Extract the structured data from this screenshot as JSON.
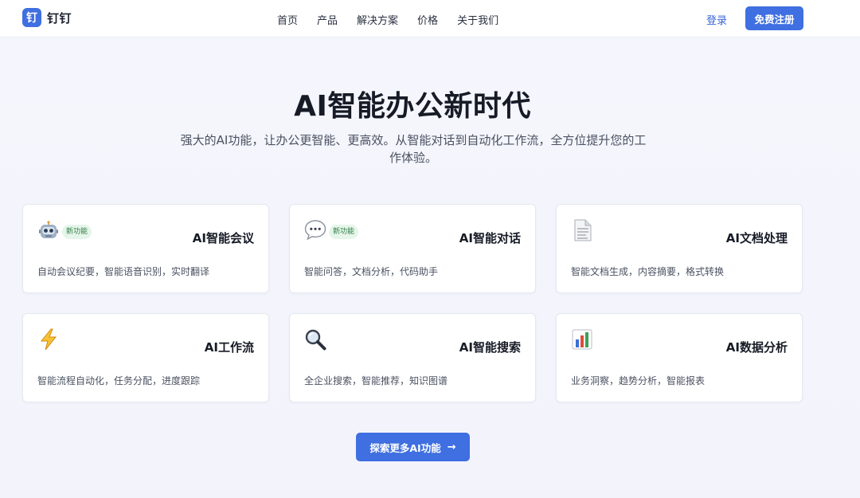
{
  "header": {
    "logo_glyph": "钉",
    "brand": "钉钉",
    "nav": [
      "首页",
      "产品",
      "解决方案",
      "价格",
      "关于我们"
    ],
    "login": "登录",
    "signup": "免费注册"
  },
  "hero": {
    "title": "AI智能办公新时代",
    "subtitle": "强大的AI功能，让办公更智能、更高效。从智能对话到自动化工作流，全方位提升您的工作体验。"
  },
  "features": [
    {
      "icon": "robot-icon",
      "badge": "新功能",
      "title": "AI智能会议",
      "desc": "自动会议纪要，智能语音识别，实时翻译"
    },
    {
      "icon": "speech-bubble-icon",
      "badge": "新功能",
      "title": "AI智能对话",
      "desc": "智能问答，文档分析，代码助手"
    },
    {
      "icon": "document-icon",
      "badge": "",
      "title": "AI文档处理",
      "desc": "智能文档生成，内容摘要，格式转换"
    },
    {
      "icon": "lightning-icon",
      "badge": "",
      "title": "AI工作流",
      "desc": "智能流程自动化，任务分配，进度跟踪"
    },
    {
      "icon": "magnifier-icon",
      "badge": "",
      "title": "AI智能搜索",
      "desc": "全企业搜索，智能推荐，知识图谱"
    },
    {
      "icon": "bar-chart-icon",
      "badge": "",
      "title": "AI数据分析",
      "desc": "业务洞察，趋势分析，智能报表"
    }
  ],
  "cta": {
    "label": "探索更多AI功能",
    "arrow": "→"
  },
  "colors": {
    "primary": "#3f6fe0",
    "badge_bg": "#e6f5ea",
    "badge_text": "#2f7d46",
    "page_bg": "#f4f5fc"
  }
}
